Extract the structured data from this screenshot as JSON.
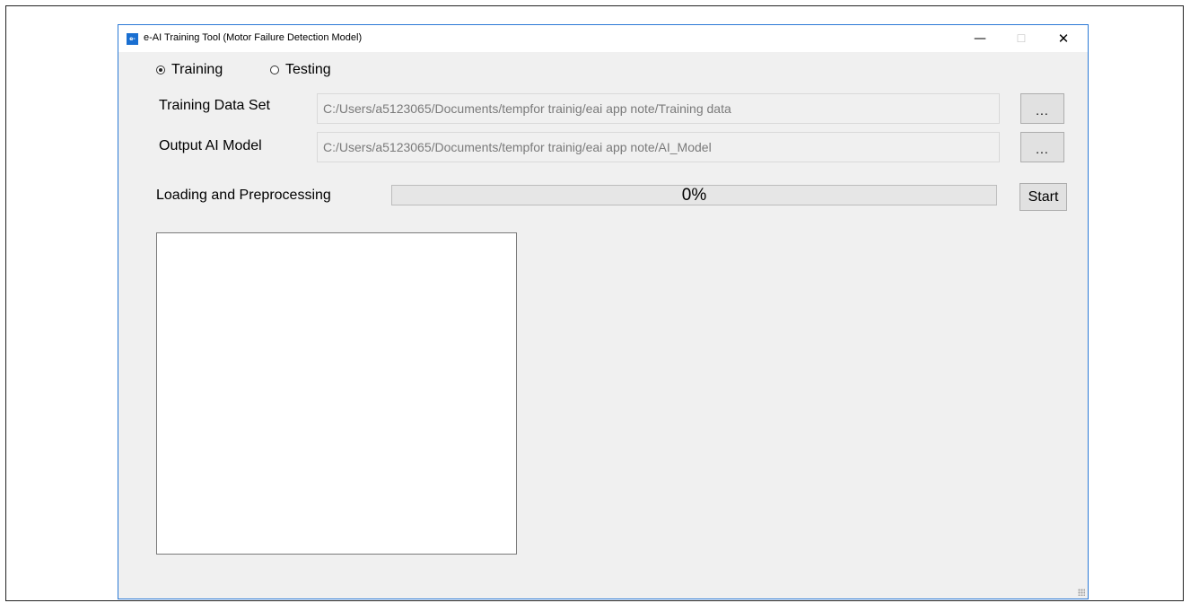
{
  "window": {
    "title": "e-AI Training Tool (Motor Failure Detection Model)",
    "icon_label": "e-AI",
    "minimize_glyph": "—",
    "maximize_glyph": "☐",
    "close_glyph": "✕"
  },
  "mode": {
    "options": [
      {
        "label": "Training",
        "checked": true
      },
      {
        "label": "Testing",
        "checked": false
      }
    ]
  },
  "training_data": {
    "label": "Training Data Set",
    "path": "C:/Users/a5123065/Documents/tempfor trainig/eai app note/Training data",
    "browse_label": "..."
  },
  "output_model": {
    "label": "Output AI Model",
    "path": "C:/Users/a5123065/Documents/tempfor trainig/eai app note/AI_Model",
    "browse_label": "..."
  },
  "progress": {
    "label": "Loading and Preprocessing",
    "value": 0,
    "text": "0%",
    "start_label": "Start"
  },
  "colors": {
    "window_border": "#2b79d6",
    "window_background": "#f0f0f0",
    "icon_background": "#1a6fd1",
    "progress_fill": "#06b025"
  }
}
